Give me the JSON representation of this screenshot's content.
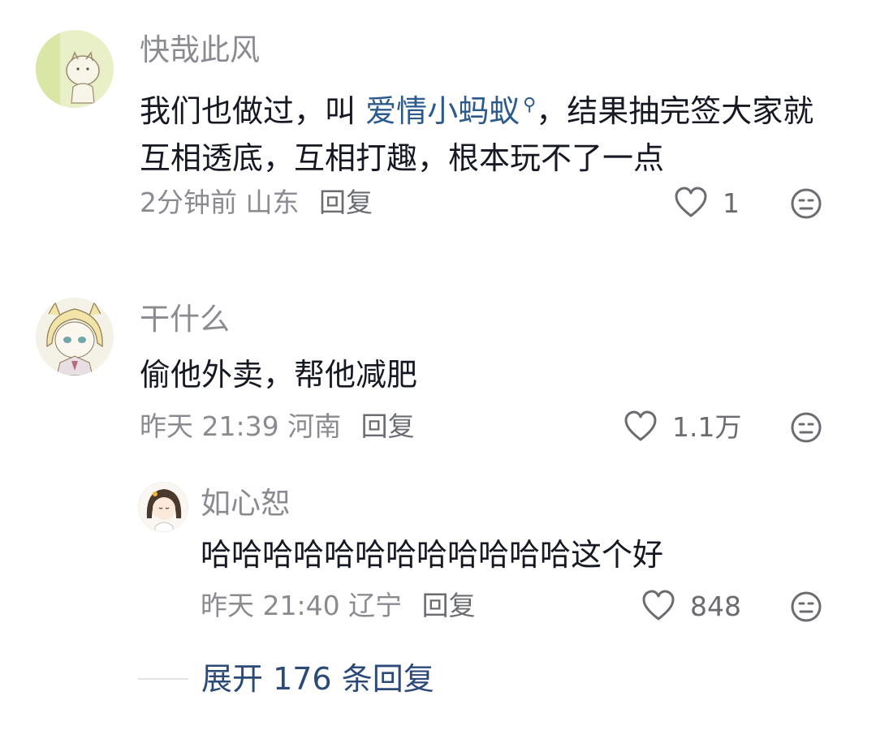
{
  "comments": [
    {
      "username": "快哉此风",
      "text_before": "我们也做过，叫 ",
      "link_text": "爱情小蚂蚁",
      "text_after": "，结果抽完签大家就互相透底，互相打趣，根本玩不了一点",
      "time": "2分钟前",
      "location": "山东",
      "reply_label": "回复",
      "likes": "1"
    },
    {
      "username": "干什么",
      "text": "偷他外卖，帮他减肥",
      "time": "昨天 21:39",
      "location": "河南",
      "reply_label": "回复",
      "likes": "1.1万"
    },
    {
      "username": "如心恕",
      "text": "哈哈哈哈哈哈哈哈哈哈哈哈这个好",
      "time": "昨天 21:40",
      "location": "辽宁",
      "reply_label": "回复",
      "likes": "848"
    }
  ],
  "expand_label": "展开 176 条回复",
  "icons": {
    "like": "heart-outline-icon",
    "dislike": "meh-face-icon",
    "search": "search-icon"
  },
  "colors": {
    "username": "#8a8b91",
    "link": "#2b5a8c",
    "expand": "#2b4a78"
  }
}
